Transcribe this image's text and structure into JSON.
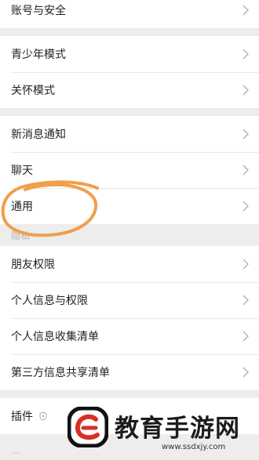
{
  "settings": {
    "group1": [
      {
        "label": "账号与安全"
      }
    ],
    "group2": [
      {
        "label": "青少年模式"
      },
      {
        "label": "关怀模式"
      }
    ],
    "group3": [
      {
        "label": "新消息通知"
      },
      {
        "label": "聊天"
      },
      {
        "label": "通用"
      }
    ],
    "privacy_section_label": "隐私",
    "group4": [
      {
        "label": "朋友权限"
      },
      {
        "label": "个人信息与权限"
      },
      {
        "label": "个人信息收集清单"
      },
      {
        "label": "第三方信息共享清单"
      }
    ],
    "group5": [
      {
        "label": "插件"
      }
    ]
  },
  "annotation": {
    "color": "#f0a04a"
  },
  "watermark": {
    "brand": "教育手游网",
    "domain": "www.ssdxjy.com"
  },
  "colors": {
    "background": "#ededed",
    "row_bg": "#ffffff",
    "chevron": "#b2b2b2"
  }
}
